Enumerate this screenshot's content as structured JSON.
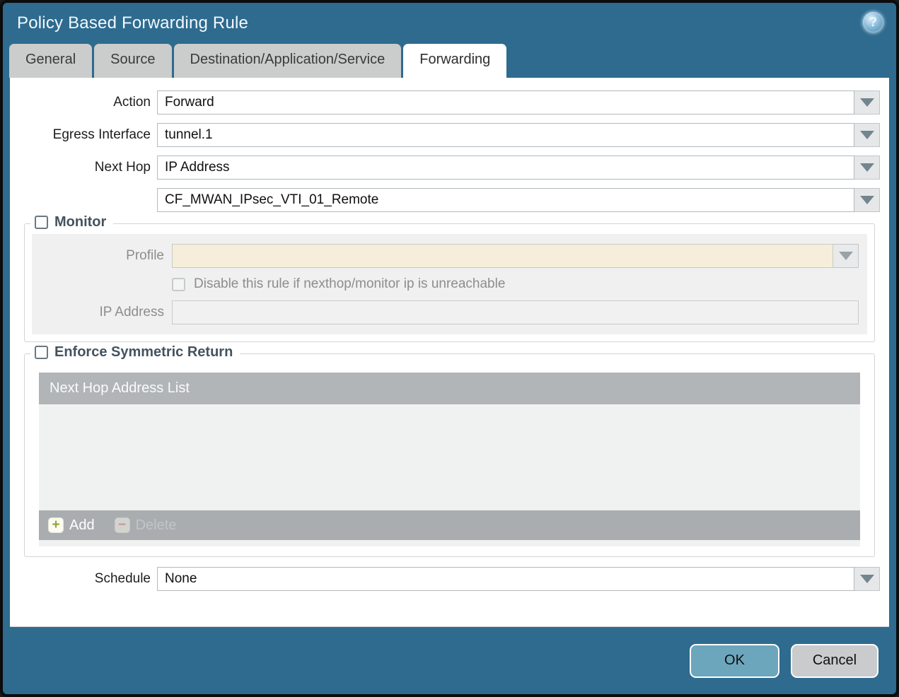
{
  "dialog": {
    "title": "Policy Based Forwarding Rule"
  },
  "tabs": [
    {
      "label": "General",
      "active": false
    },
    {
      "label": "Source",
      "active": false
    },
    {
      "label": "Destination/Application/Service",
      "active": false
    },
    {
      "label": "Forwarding",
      "active": true
    }
  ],
  "form": {
    "action": {
      "label": "Action",
      "value": "Forward"
    },
    "egress_interface": {
      "label": "Egress Interface",
      "value": "tunnel.1"
    },
    "next_hop": {
      "label": "Next Hop",
      "value": "IP Address"
    },
    "next_hop_address": {
      "value": "CF_MWAN_IPsec_VTI_01_Remote"
    },
    "schedule": {
      "label": "Schedule",
      "value": "None"
    }
  },
  "monitor": {
    "legend": "Monitor",
    "checked": false,
    "profile": {
      "label": "Profile",
      "value": ""
    },
    "disable_rule": {
      "label": "Disable this rule if nexthop/monitor ip is unreachable",
      "checked": false
    },
    "ip_address": {
      "label": "IP Address",
      "value": ""
    }
  },
  "enforce_symmetric_return": {
    "legend": "Enforce Symmetric Return",
    "checked": false,
    "table": {
      "header": "Next Hop Address List",
      "rows": [],
      "add_label": "Add",
      "delete_label": "Delete",
      "delete_enabled": false
    }
  },
  "footer": {
    "ok_label": "OK",
    "cancel_label": "Cancel"
  },
  "icons": {
    "help": "?",
    "add_plus": "+",
    "delete_minus": "−"
  },
  "colors": {
    "frame_teal": "#2e6b8f",
    "tab_inactive": "#cbcccc",
    "tab_active": "#ffffff",
    "disabled_field_beige": "#f6eedb",
    "table_header_gray": "#b1b5b7",
    "ok_button": "#6ca6bc",
    "cancel_button": "#c9cbcd",
    "add_plus_green": "#97a134",
    "delete_minus_red": "#cf9096"
  }
}
